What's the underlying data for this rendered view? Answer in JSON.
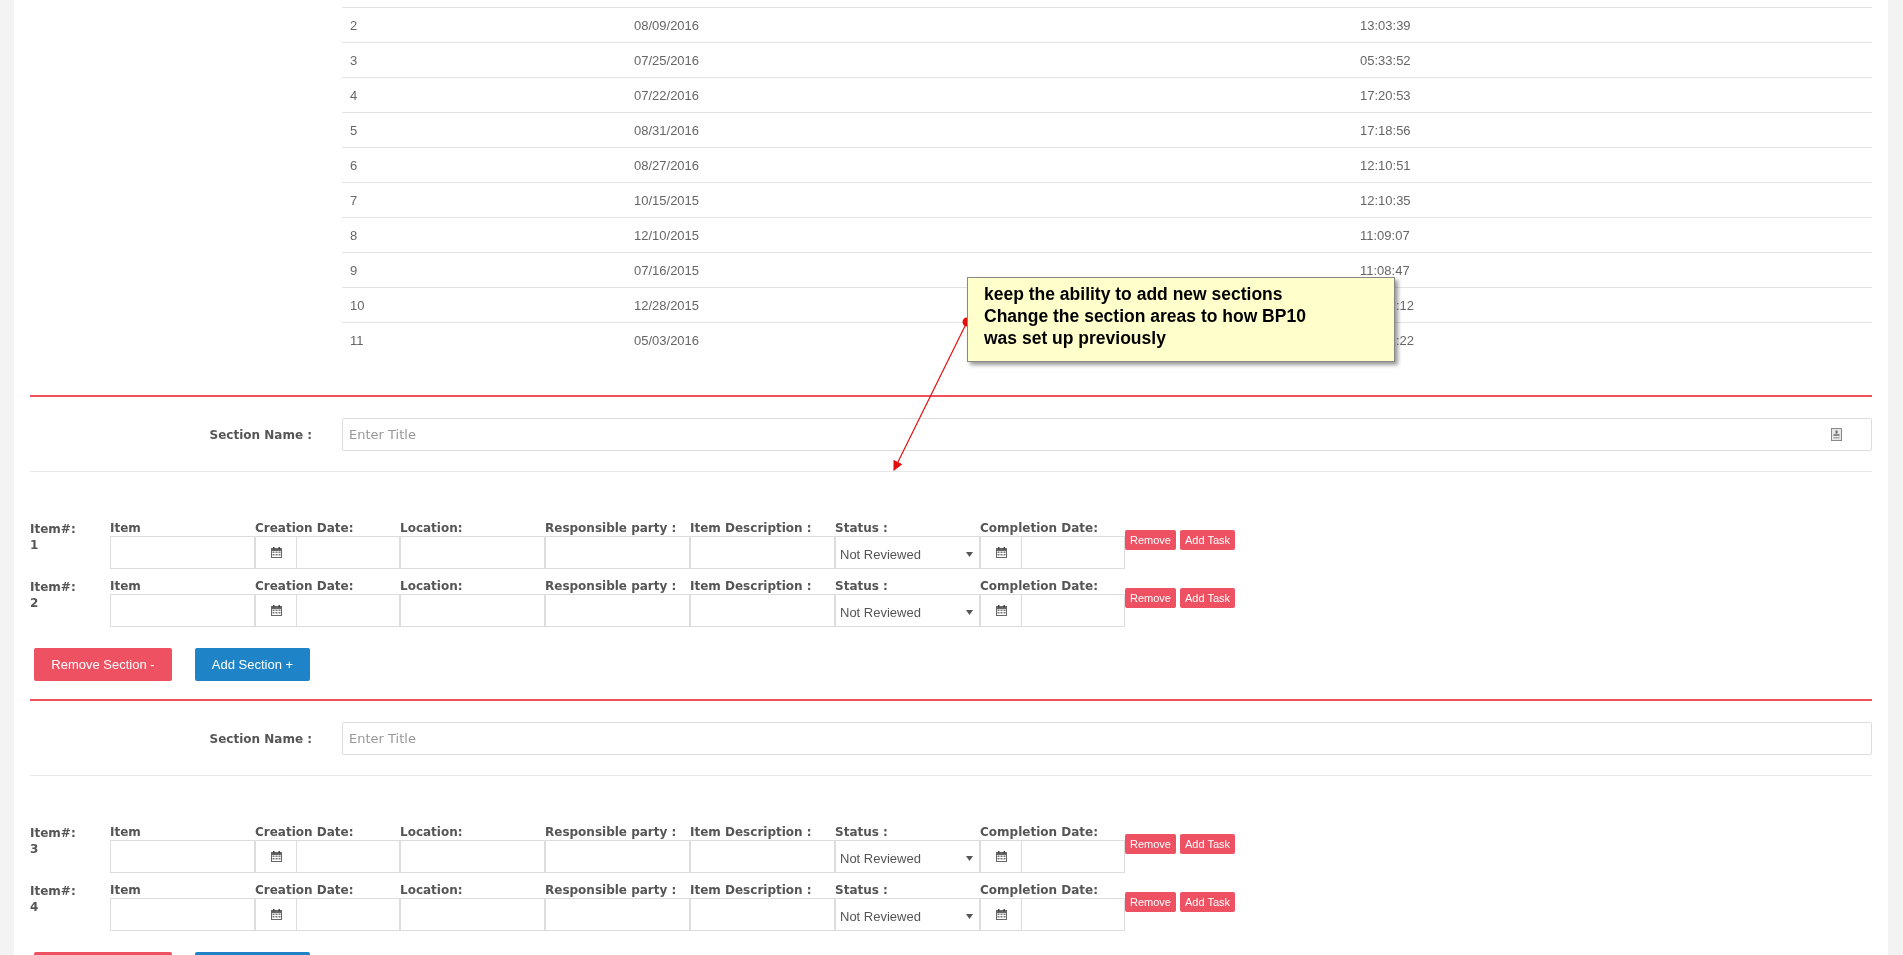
{
  "table": {
    "rows": [
      {
        "number": "2",
        "date": "08/09/2016",
        "time": "13:03:39",
        "covered": false
      },
      {
        "number": "3",
        "date": "07/25/2016",
        "time": "05:33:52",
        "covered": false
      },
      {
        "number": "4",
        "date": "07/22/2016",
        "time": "17:20:53",
        "covered": false
      },
      {
        "number": "5",
        "date": "08/31/2016",
        "time": "17:18:56",
        "covered": false
      },
      {
        "number": "6",
        "date": "08/27/2016",
        "time": "12:10:51",
        "covered": false
      },
      {
        "number": "7",
        "date": "10/15/2015",
        "time": "12:10:35",
        "covered": false
      },
      {
        "number": "8",
        "date": "12/10/2015",
        "time": "11:09:07",
        "covered": false
      },
      {
        "number": "9",
        "date": "07/16/2015",
        "time": "11:08:47",
        "covered": false
      },
      {
        "number": "10",
        "date": "12/28/2015",
        "time": ":12",
        "covered": true
      },
      {
        "number": "11",
        "date": "05/03/2016",
        "time": ":22",
        "covered": true
      }
    ]
  },
  "callout": {
    "lines": [
      "keep the ability to add new sections",
      "Change the section areas to how BP10",
      "was set up previously"
    ]
  },
  "sections": [
    {
      "label": "Section Name :",
      "placeholder": "Enter Title",
      "title_icon": true,
      "items": [
        {
          "number_label": "Item#:",
          "number": "1",
          "fields": [
            {
              "kind": "text",
              "label": "Item"
            },
            {
              "kind": "date",
              "label": "Creation Date:"
            },
            {
              "kind": "text",
              "label": "Location:"
            },
            {
              "kind": "text",
              "label": "Responsible party :"
            },
            {
              "kind": "text",
              "label": "Item Description :"
            },
            {
              "kind": "select",
              "label": "Status :",
              "value": "Not Reviewed"
            },
            {
              "kind": "date",
              "label": "Completion Date:"
            }
          ],
          "buttons": [
            "Remove",
            "Add Task"
          ]
        },
        {
          "number_label": "Item#:",
          "number": "2",
          "fields": [
            {
              "kind": "text",
              "label": "Item"
            },
            {
              "kind": "date",
              "label": "Creation Date:"
            },
            {
              "kind": "text",
              "label": "Location:"
            },
            {
              "kind": "text",
              "label": "Responsible party :"
            },
            {
              "kind": "text",
              "label": "Item Description :"
            },
            {
              "kind": "select",
              "label": "Status :",
              "value": "Not Reviewed"
            },
            {
              "kind": "date",
              "label": "Completion Date:"
            }
          ],
          "buttons": [
            "Remove",
            "Add Task"
          ]
        }
      ],
      "actions": [
        {
          "kind": "remove",
          "label": "Remove Section -"
        },
        {
          "kind": "add",
          "label": "Add Section +"
        }
      ]
    },
    {
      "label": "Section Name :",
      "placeholder": "Enter Title",
      "title_icon": false,
      "items": [
        {
          "number_label": "Item#:",
          "number": "3",
          "fields": [
            {
              "kind": "text",
              "label": "Item"
            },
            {
              "kind": "date",
              "label": "Creation Date:"
            },
            {
              "kind": "text",
              "label": "Location:"
            },
            {
              "kind": "text",
              "label": "Responsible party :"
            },
            {
              "kind": "text",
              "label": "Item Description :"
            },
            {
              "kind": "select",
              "label": "Status :",
              "value": "Not Reviewed"
            },
            {
              "kind": "date",
              "label": "Completion Date:"
            }
          ],
          "buttons": [
            "Remove",
            "Add Task"
          ]
        },
        {
          "number_label": "Item#:",
          "number": "4",
          "fields": [
            {
              "kind": "text",
              "label": "Item"
            },
            {
              "kind": "date",
              "label": "Creation Date:"
            },
            {
              "kind": "text",
              "label": "Location:"
            },
            {
              "kind": "text",
              "label": "Responsible party :"
            },
            {
              "kind": "text",
              "label": "Item Description :"
            },
            {
              "kind": "select",
              "label": "Status :",
              "value": "Not Reviewed"
            },
            {
              "kind": "date",
              "label": "Completion Date:"
            }
          ],
          "buttons": [
            "Remove",
            "Add Task"
          ]
        }
      ],
      "actions": [
        {
          "kind": "remove"
        },
        {
          "kind": "add"
        }
      ]
    }
  ]
}
